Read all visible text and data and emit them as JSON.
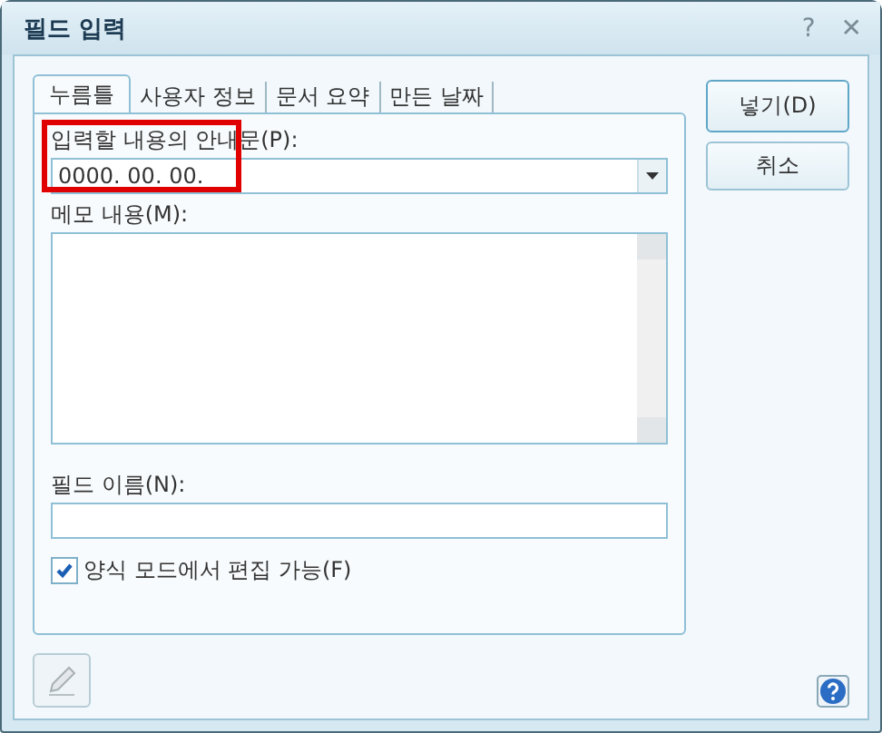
{
  "window": {
    "title": "필드 입력",
    "help_glyph": "?",
    "close_glyph": "✕"
  },
  "tabs": [
    {
      "label": "누름틀",
      "selected": true
    },
    {
      "label": "사용자 정보",
      "selected": false
    },
    {
      "label": "문서 요약",
      "selected": false
    },
    {
      "label": "만든 날짜",
      "selected": false
    }
  ],
  "prompt": {
    "label": "입력할 내용의 안내문(P):",
    "value": "0000. 00. 00."
  },
  "memo": {
    "label": "메모 내용(M):"
  },
  "field_name": {
    "label": "필드 이름(N):"
  },
  "editable_in_form": {
    "label": "양식 모드에서 편집 가능(F)",
    "checked": true
  },
  "buttons": [
    "넣기(D)",
    "취소"
  ],
  "annotation": {
    "kind": "rectangle",
    "color": "#e00000"
  }
}
